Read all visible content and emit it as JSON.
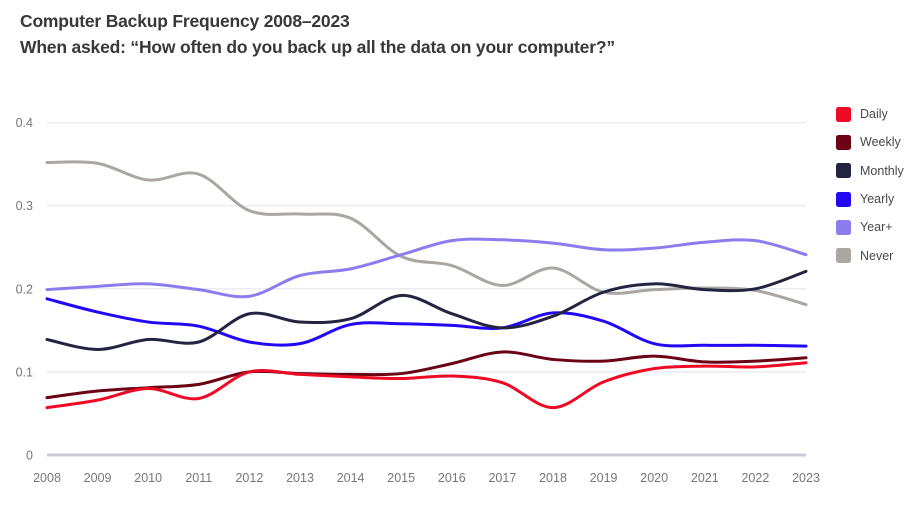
{
  "header": {
    "title_line1": "Computer Backup Frequency 2008–2023",
    "title_line2": "When asked: “How often do you back up all the data on your computer?”"
  },
  "chart_data": {
    "type": "line",
    "title": "Computer Backup Frequency 2008–2023",
    "subtitle": "When asked: “How often do you back up all the data on your computer?”",
    "xlabel": "",
    "ylabel": "",
    "x": [
      2008,
      2009,
      2010,
      2011,
      2012,
      2013,
      2014,
      2015,
      2016,
      2017,
      2018,
      2019,
      2020,
      2021,
      2022,
      2023
    ],
    "categories": [
      "2008",
      "2009",
      "2010",
      "2011",
      "2012",
      "2013",
      "2014",
      "2015",
      "2016",
      "2017",
      "2018",
      "2019",
      "2020",
      "2021",
      "2022",
      "2023"
    ],
    "xlim": [
      2008,
      2023
    ],
    "ylim": [
      0,
      0.42
    ],
    "yticks": [
      0,
      0.1,
      0.2,
      0.3,
      0.4
    ],
    "ytick_labels": [
      "0",
      "0.1",
      "0.2",
      "0.3",
      "0.4"
    ],
    "grid": true,
    "legend_position": "right",
    "smoothing": "spline",
    "series": [
      {
        "name": "Daily",
        "color": "#ee0a24",
        "values": [
          0.057,
          0.066,
          0.08,
          0.068,
          0.1,
          0.097,
          0.094,
          0.092,
          0.095,
          0.087,
          0.057,
          0.088,
          0.104,
          0.107,
          0.106,
          0.111
        ]
      },
      {
        "name": "Weekly",
        "color": "#6b0216",
        "values": [
          0.069,
          0.077,
          0.081,
          0.085,
          0.1,
          0.098,
          0.097,
          0.098,
          0.11,
          0.124,
          0.115,
          0.113,
          0.119,
          0.112,
          0.113,
          0.117
        ]
      },
      {
        "name": "Monthly",
        "color": "#232440",
        "values": [
          0.139,
          0.127,
          0.139,
          0.136,
          0.17,
          0.16,
          0.164,
          0.192,
          0.17,
          0.153,
          0.167,
          0.196,
          0.206,
          0.199,
          0.2,
          0.221
        ]
      },
      {
        "name": "Yearly",
        "color": "#2308f5",
        "values": [
          0.188,
          0.172,
          0.16,
          0.155,
          0.136,
          0.134,
          0.157,
          0.158,
          0.156,
          0.153,
          0.171,
          0.161,
          0.134,
          0.132,
          0.132,
          0.131
        ]
      },
      {
        "name": "Year+",
        "color": "#8b7dee",
        "values": [
          0.199,
          0.203,
          0.206,
          0.199,
          0.191,
          0.216,
          0.224,
          0.241,
          0.258,
          0.259,
          0.255,
          0.247,
          0.249,
          0.256,
          0.258,
          0.241
        ]
      },
      {
        "name": "Never",
        "color": "#aaa7a2",
        "values": [
          0.352,
          0.351,
          0.331,
          0.338,
          0.294,
          0.29,
          0.285,
          0.239,
          0.228,
          0.204,
          0.225,
          0.196,
          0.199,
          0.201,
          0.198,
          0.181
        ]
      }
    ]
  },
  "legend": {
    "items": [
      {
        "label": "Daily",
        "color": "#ee0a24"
      },
      {
        "label": "Weekly",
        "color": "#6b0216"
      },
      {
        "label": "Monthly",
        "color": "#232440"
      },
      {
        "label": "Yearly",
        "color": "#2308f5"
      },
      {
        "label": "Year+",
        "color": "#8b7dee"
      },
      {
        "label": "Never",
        "color": "#aaa7a2"
      }
    ]
  }
}
